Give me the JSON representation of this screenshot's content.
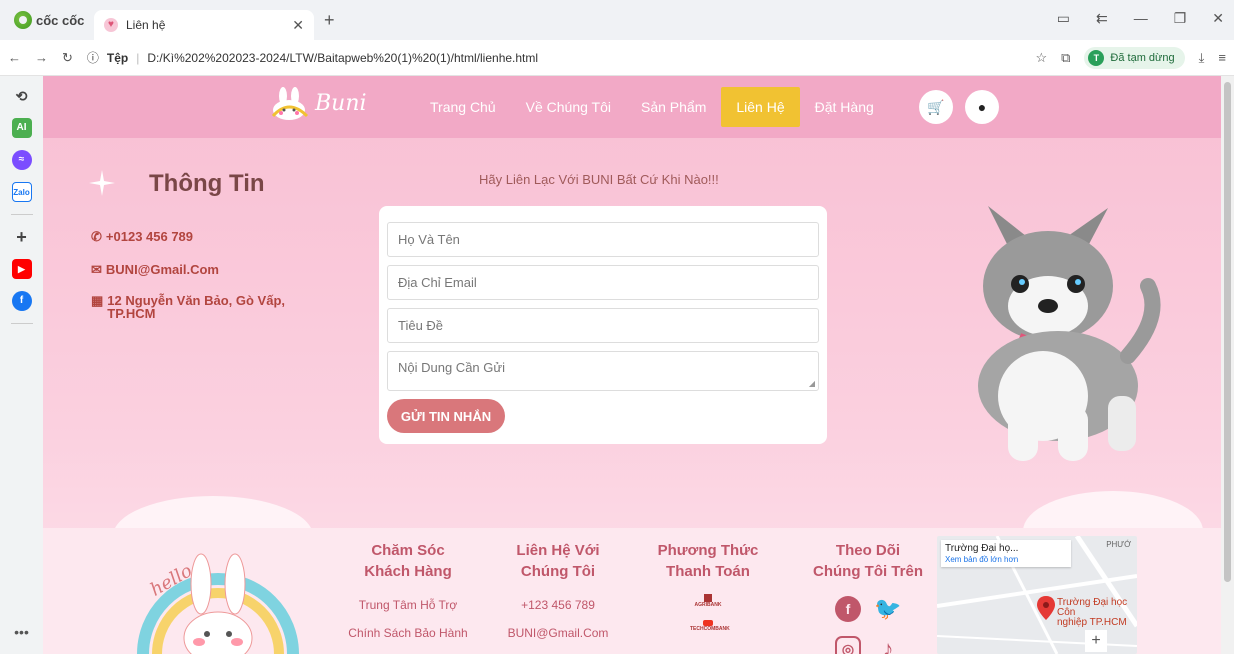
{
  "browser": {
    "brand": "cốc cốc",
    "tab_title": "Liên hệ",
    "url_prefix": "Tệp",
    "url": "D:/Kì%202%202023-2024/LTW/Baitapweb%20(1)%20(1)/html/lienhe.html",
    "profile_initial": "T",
    "profile_status": "Đã tạm dừng"
  },
  "site": {
    "logo_text": "Buni",
    "nav": [
      "Trang Chủ",
      "Về Chúng Tôi",
      "Sản Phẩm",
      "Liên Hệ",
      "Đặt Hàng"
    ],
    "active_nav": "Liên Hệ"
  },
  "info": {
    "title": "Thông Tin",
    "phone": "+0123 456 789",
    "email": "BUNI@Gmail.Com",
    "address": "12 Nguyễn Văn Bảo, Gò Vấp, TP.HCM"
  },
  "form": {
    "heading": "Hãy Liên Lạc Với BUNI Bất Cứ Khi Nào!!!",
    "name_placeholder": "Họ Và Tên",
    "email_placeholder": "Địa Chỉ Email",
    "subject_placeholder": "Tiêu Đề",
    "message_placeholder": "Nội Dung Cần Gửi",
    "submit_label": "GỬI TIN NHẮN"
  },
  "footer": {
    "col1": {
      "head1": "Chăm Sóc",
      "head2": "Khách Hàng",
      "items": [
        "Trung Tâm Hỗ Trợ",
        "Chính Sách Bảo Hành"
      ]
    },
    "col2": {
      "head1": "Liên Hệ Với",
      "head2": "Chúng Tôi",
      "items": [
        "+123 456 789",
        "BUNI@Gmail.Com"
      ]
    },
    "col3": {
      "head1": "Phương Thức",
      "head2": "Thanh Toán",
      "banks": [
        "AGRIBANK",
        "TECHCOMBANK"
      ]
    },
    "col4": {
      "head1": "Theo Dõi",
      "head2": "Chúng Tôi Trên"
    },
    "hello_text": "hello",
    "map": {
      "place": "Trường Đại họ...",
      "link": "Xem bản đồ lớn hơn",
      "marker_line1": "Trường Đại học Côn",
      "marker_line2": "nghiệp TP.HCM",
      "area": "PHƯỚ"
    }
  }
}
